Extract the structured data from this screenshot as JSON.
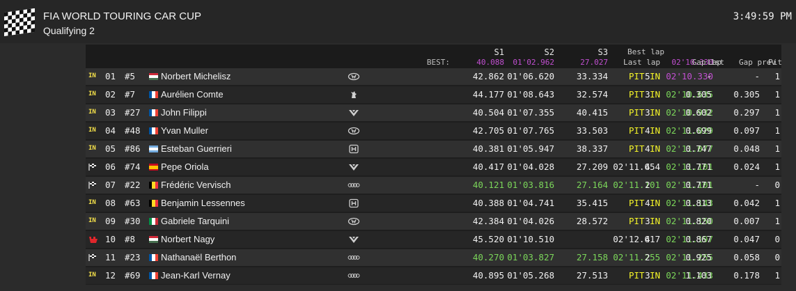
{
  "header": {
    "title": "FIA WORLD TOURING CAR CUP",
    "subtitle": "Qualifying 2",
    "clock": "3:49:59 PM",
    "logo_icon": "checkered-flag-icon"
  },
  "columns": {
    "best_label": "BEST:",
    "s1": "S1",
    "s2": "S2",
    "s3": "S3",
    "best_s1": "40.088",
    "best_s2": "01'02.962",
    "best_s3": "27.027",
    "last_lap": "Last lap",
    "best_lap": "Best lap",
    "best_lap_value": "02'10.330",
    "lap": "Lap",
    "gap_first": "Gap 1st",
    "gap_prev": "Gap prev",
    "pit": "Pit"
  },
  "colors": {
    "purple": "#c14fd1",
    "green": "#7bd65a",
    "yellow": "#f5f528",
    "status": "#f5e14a"
  },
  "rows": [
    {
      "status": "IN",
      "pos": "01",
      "num": "#5",
      "flag": [
        "#ce2939",
        "#ffffff",
        "#477050"
      ],
      "driver": "Norbert Michelisz",
      "brand": "hyundai",
      "s1": "42.862",
      "s1c": "white",
      "s2": "01'06.620",
      "s2c": "white",
      "s3": "33.334",
      "s3c": "white",
      "last": "PIT IN",
      "lastc": "pit",
      "best": "02'10.330",
      "bestc": "purple",
      "lap": "5",
      "gap1": "-",
      "gapp": "-",
      "pit": "1"
    },
    {
      "status": "IN",
      "pos": "02",
      "num": "#7",
      "flag": [
        "#0055a4",
        "#ffffff",
        "#ef4135"
      ],
      "driver": "Aurélien Comte",
      "brand": "peugeot",
      "s1": "44.177",
      "s1c": "white",
      "s2": "01'08.643",
      "s2c": "white",
      "s3": "32.574",
      "s3c": "white",
      "last": "PIT IN",
      "lastc": "pit",
      "best": "02'10.635",
      "bestc": "green",
      "lap": "3",
      "gap1": "0.305",
      "gapp": "0.305",
      "pit": "1"
    },
    {
      "status": "IN",
      "pos": "03",
      "num": "#27",
      "flag": [
        "#0055a4",
        "#ffffff",
        "#ef4135"
      ],
      "driver": "John Filippi",
      "brand": "cupra",
      "s1": "40.504",
      "s1c": "white",
      "s2": "01'07.355",
      "s2c": "white",
      "s3": "40.415",
      "s3c": "white",
      "last": "PIT IN",
      "lastc": "pit",
      "best": "02'10.932",
      "bestc": "green",
      "lap": "3",
      "gap1": "0.602",
      "gapp": "0.297",
      "pit": "1"
    },
    {
      "status": "IN",
      "pos": "04",
      "num": "#48",
      "flag": [
        "#0055a4",
        "#ffffff",
        "#ef4135"
      ],
      "driver": "Yvan Muller",
      "brand": "hyundai",
      "s1": "42.705",
      "s1c": "white",
      "s2": "01'07.765",
      "s2c": "white",
      "s3": "33.503",
      "s3c": "white",
      "last": "PIT IN",
      "lastc": "pit",
      "best": "02'11.029",
      "bestc": "green",
      "lap": "4",
      "gap1": "0.699",
      "gapp": "0.097",
      "pit": "1"
    },
    {
      "status": "IN",
      "pos": "05",
      "num": "#86",
      "flag": [
        "#74acdf",
        "#ffffff",
        "#74acdf"
      ],
      "driver": "Esteban Guerrieri",
      "brand": "honda",
      "s1": "40.381",
      "s1c": "white",
      "s2": "01'05.947",
      "s2c": "white",
      "s3": "38.337",
      "s3c": "white",
      "last": "PIT IN",
      "lastc": "pit",
      "best": "02'11.077",
      "bestc": "green",
      "lap": "4",
      "gap1": "0.747",
      "gapp": "0.048",
      "pit": "1"
    },
    {
      "status": "flag",
      "pos": "06",
      "num": "#74",
      "flag": [
        "#c60b1e",
        "#ffc400",
        "#c60b1e"
      ],
      "driver": "Pepe Oriola",
      "brand": "cupra",
      "s1": "40.417",
      "s1c": "white",
      "s2": "01'04.028",
      "s2c": "white",
      "s3": "27.209",
      "s3c": "white",
      "last": "02'11.654",
      "lastc": "white",
      "best": "02'11.101",
      "bestc": "green",
      "lap": "4",
      "gap1": "0.771",
      "gapp": "0.024",
      "pit": "1"
    },
    {
      "status": "flag",
      "pos": "07",
      "num": "#22",
      "flag": [
        "#000000",
        "#fdda24",
        "#ef3340"
      ],
      "driver": "Frédéric Vervisch",
      "brand": "audi",
      "s1": "40.121",
      "s1c": "green",
      "s2": "01'03.816",
      "s2c": "green",
      "s3": "27.164",
      "s3c": "green",
      "last": "02'11.101",
      "lastc": "green",
      "best": "02'11.101",
      "bestc": "green",
      "lap": "2",
      "gap1": "0.771",
      "gapp": "-",
      "pit": "0"
    },
    {
      "status": "IN",
      "pos": "08",
      "num": "#63",
      "flag": [
        "#000000",
        "#fdda24",
        "#ef3340"
      ],
      "driver": "Benjamin Lessennes",
      "brand": "honda",
      "s1": "40.388",
      "s1c": "white",
      "s2": "01'04.741",
      "s2c": "white",
      "s3": "35.415",
      "s3c": "white",
      "last": "PIT IN",
      "lastc": "pit",
      "best": "02'11.143",
      "bestc": "green",
      "lap": "4",
      "gap1": "0.813",
      "gapp": "0.042",
      "pit": "1"
    },
    {
      "status": "IN",
      "pos": "09",
      "num": "#30",
      "flag": [
        "#009246",
        "#ffffff",
        "#ce2b37"
      ],
      "driver": "Gabriele Tarquini",
      "brand": "hyundai",
      "s1": "42.384",
      "s1c": "white",
      "s2": "01'04.026",
      "s2c": "white",
      "s3": "28.572",
      "s3c": "white",
      "last": "PIT IN",
      "lastc": "pit",
      "best": "02'11.150",
      "bestc": "green",
      "lap": "3",
      "gap1": "0.820",
      "gapp": "0.007",
      "pit": "1"
    },
    {
      "status": "alert",
      "pos": "10",
      "num": "#8",
      "flag": [
        "#ce2939",
        "#ffffff",
        "#477050"
      ],
      "driver": "Norbert Nagy",
      "brand": "cupra",
      "s1": "45.520",
      "s1c": "white",
      "s2": "01'10.510",
      "s2c": "white",
      "s3": "",
      "s3c": "white",
      "last": "02'12.617",
      "lastc": "white",
      "best": "02'11.197",
      "bestc": "green",
      "lap": "4",
      "gap1": "0.867",
      "gapp": "0.047",
      "pit": "0"
    },
    {
      "status": "flag",
      "pos": "11",
      "num": "#23",
      "flag": [
        "#0055a4",
        "#ffffff",
        "#ef4135"
      ],
      "driver": "Nathanaël Berthon",
      "brand": "audi",
      "s1": "40.270",
      "s1c": "green",
      "s2": "01'03.827",
      "s2c": "green",
      "s3": "27.158",
      "s3c": "green",
      "last": "02'11.255",
      "lastc": "green",
      "best": "02'11.255",
      "bestc": "green",
      "lap": "2",
      "gap1": "0.925",
      "gapp": "0.058",
      "pit": "0"
    },
    {
      "status": "IN",
      "pos": "12",
      "num": "#69",
      "flag": [
        "#0055a4",
        "#ffffff",
        "#ef4135"
      ],
      "driver": "Jean-Karl Vernay",
      "brand": "audi",
      "s1": "40.895",
      "s1c": "white",
      "s2": "01'05.268",
      "s2c": "white",
      "s3": "27.513",
      "s3c": "white",
      "last": "PIT IN",
      "lastc": "pit",
      "best": "02'11.433",
      "bestc": "green",
      "lap": "3",
      "gap1": "1.103",
      "gapp": "0.178",
      "pit": "1"
    }
  ]
}
